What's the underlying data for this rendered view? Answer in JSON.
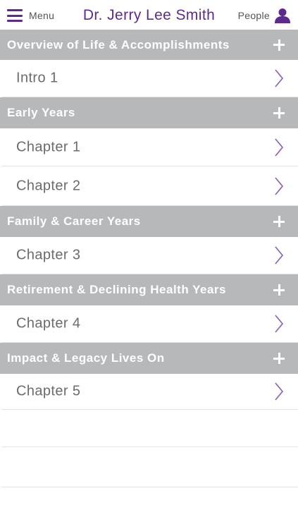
{
  "header": {
    "menu_label": "Menu",
    "title": "Dr. Jerry Lee Smith",
    "people_label": "People",
    "accent_color": "#5f2a8e"
  },
  "sections": [
    {
      "title": "Overview of Life & Accomplishments",
      "items": [
        {
          "label": "Intro 1"
        }
      ]
    },
    {
      "title": "Early Years",
      "items": [
        {
          "label": "Chapter 1"
        },
        {
          "label": "Chapter 2"
        }
      ]
    },
    {
      "title": "Family & Career Years",
      "items": [
        {
          "label": "Chapter 3"
        }
      ]
    },
    {
      "title": "Retirement & Declining Health Years",
      "items": [
        {
          "label": "Chapter 4"
        }
      ]
    },
    {
      "title": "Impact & Legacy Lives On",
      "items": [
        {
          "label": "Chapter 5"
        }
      ]
    }
  ],
  "icons": {
    "menu": "hamburger-icon",
    "people": "person-icon",
    "section_expand": "plus-icon",
    "row_disclosure": "chevron-right-icon"
  },
  "colors": {
    "section_header_bg": "#b7b8ba",
    "text_gray": "#6b6b6b"
  }
}
